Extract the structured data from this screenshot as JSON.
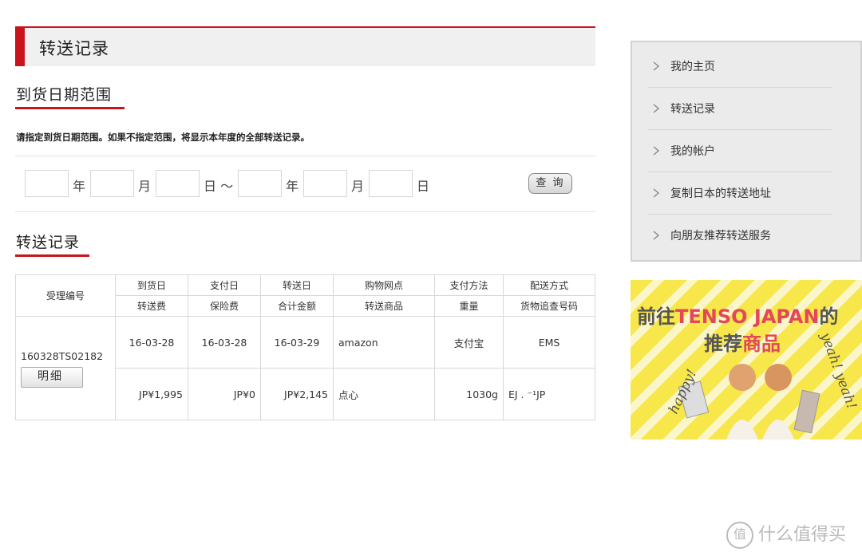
{
  "page_title": "转送记录",
  "date_range": {
    "heading": "到货日期范围",
    "note": "请指定到货日期范围。如果不指定范围，将显示本年度的全部转送记录。",
    "labels": {
      "year": "年",
      "month": "月",
      "day_to": "日 ～",
      "year2": "年",
      "month2": "月",
      "day2": "日"
    },
    "search_label": "查 询"
  },
  "records": {
    "heading": "转送记录",
    "header_row1": [
      "到货日",
      "支付日",
      "转送日",
      "购物网点",
      "支付方法",
      "配送方式"
    ],
    "header_row2": [
      "转送费",
      "保险费",
      "合计金额",
      "转送商品",
      "重量",
      "货物追查号码"
    ],
    "id_header": "受理编号",
    "rows": [
      {
        "id": "160328TS02182",
        "detail_label": "明细",
        "line1": [
          "16-03-28",
          "16-03-28",
          "16-03-29",
          "amazon",
          "支付宝",
          "EMS"
        ],
        "line2": [
          "JP¥1,995",
          "JP¥0",
          "JP¥2,145",
          "点心",
          "1030g",
          "EJ .          ⁻¹JP"
        ]
      }
    ]
  },
  "sidebar": {
    "items": [
      {
        "label": "我的主页"
      },
      {
        "label": "转送记录"
      },
      {
        "label": "我的帐户"
      },
      {
        "label": "复制日本的转送地址"
      },
      {
        "label": "向朋友推荐转送服务"
      }
    ]
  },
  "banner": {
    "line1_pre": "前往",
    "line1_em": "TENSO JAPAN",
    "line1_post": "的",
    "line2_pre": "推荐",
    "line2_em": "商品",
    "script_left": "happy!",
    "script_right": "yeah! yeah!"
  },
  "watermark": {
    "icon": "值",
    "text": "什么值得买"
  },
  "colors": {
    "accent": "#c8151b",
    "banner_yellow": "#f7e74a",
    "banner_pink": "#e2475c"
  }
}
